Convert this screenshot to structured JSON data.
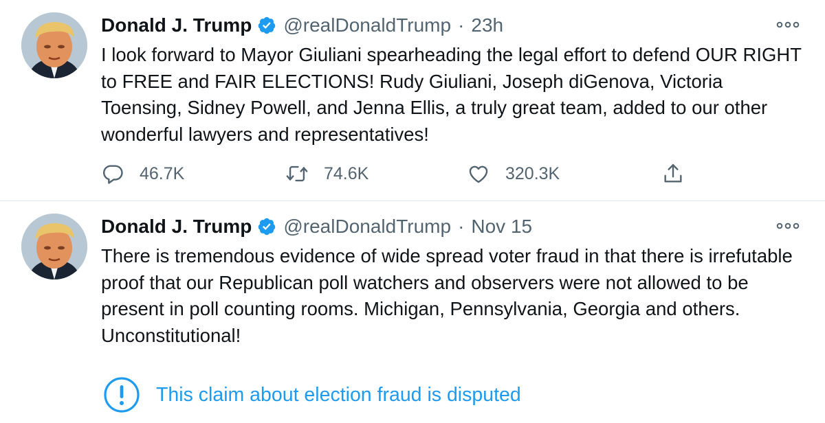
{
  "tweets": [
    {
      "author": "Donald J. Trump",
      "handle": "@realDonaldTrump",
      "separator": "·",
      "time": "23h",
      "text": "I look forward to Mayor Giuliani spearheading the legal effort to defend OUR RIGHT to FREE and FAIR ELECTIONS! Rudy Giuliani, Joseph diGenova, Victoria Toensing, Sidney Powell, and Jenna Ellis, a truly great team, added to our other wonderful lawyers and representatives!",
      "replies": "46.7K",
      "retweets": "74.6K",
      "likes": "320.3K"
    },
    {
      "author": "Donald J. Trump",
      "handle": "@realDonaldTrump",
      "separator": "·",
      "time": "Nov 15",
      "text": "There is tremendous evidence of wide spread voter fraud in that there is irrefutable proof that our Republican poll watchers and observers were not allowed to be present in poll counting rooms. Michigan, Pennsylvania, Georgia and others. Unconstitutional!",
      "notice": "This claim about election fraud is disputed"
    }
  ],
  "colors": {
    "accent": "#1d9bf0",
    "text": "#0f1419",
    "secondary": "#536471",
    "divider": "#e1e8ed"
  },
  "icons": {
    "verified": "verified-badge-icon",
    "more": "more-icon",
    "reply": "reply-icon",
    "retweet": "retweet-icon",
    "like": "like-icon",
    "share": "share-icon",
    "notice": "exclamation-circle-icon"
  }
}
